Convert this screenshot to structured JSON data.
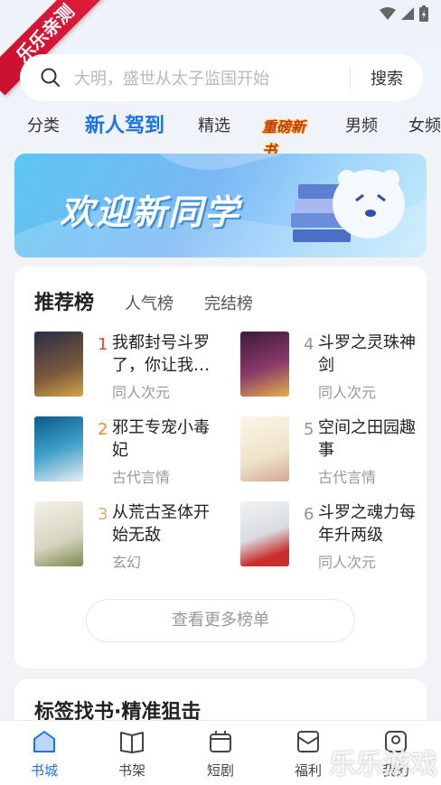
{
  "watermark": {
    "ribbon": "乐乐亲测",
    "corner": "乐乐游戏"
  },
  "search": {
    "placeholder": "大明，盛世从太子监国开始",
    "button": "搜索"
  },
  "tabs": [
    {
      "label": "分类"
    },
    {
      "label": "新人驾到",
      "active": true
    },
    {
      "label": "精选"
    },
    {
      "label": "重磅新书"
    },
    {
      "label": "男频"
    },
    {
      "label": "女频"
    }
  ],
  "banner": {
    "text": "欢迎新同学"
  },
  "ranking": {
    "title": "推荐榜",
    "tabs": [
      "人气榜",
      "完结榜"
    ],
    "books": [
      {
        "rank": "1",
        "title": "我都封号斗罗了，你让我…",
        "tag": "同人次元",
        "rank_color": "#e8463b"
      },
      {
        "rank": "2",
        "title": "邪王专宠小毒妃",
        "tag": "古代言情",
        "rank_color": "#f08a2c"
      },
      {
        "rank": "3",
        "title": "从荒古圣体开始无敌",
        "tag": "玄幻",
        "rank_color": "#e0ad6a"
      },
      {
        "rank": "4",
        "title": "斗罗之灵珠神剑",
        "tag": "同人次元",
        "rank_color": "#8a94a6"
      },
      {
        "rank": "5",
        "title": "空间之田园趣事",
        "tag": "古代言情",
        "rank_color": "#8a94a6"
      },
      {
        "rank": "6",
        "title": "斗罗之魂力每年升两级",
        "tag": "同人次元",
        "rank_color": "#8a94a6"
      }
    ],
    "more": "查看更多榜单"
  },
  "tag_section": {
    "title": "标签找书·精准狙击"
  },
  "nav": [
    {
      "label": "书城",
      "active": true
    },
    {
      "label": "书架"
    },
    {
      "label": "短剧"
    },
    {
      "label": "福利"
    },
    {
      "label": "我的"
    }
  ],
  "colors": {
    "accent": "#1a73e8",
    "ribbon": "#d4142f"
  }
}
